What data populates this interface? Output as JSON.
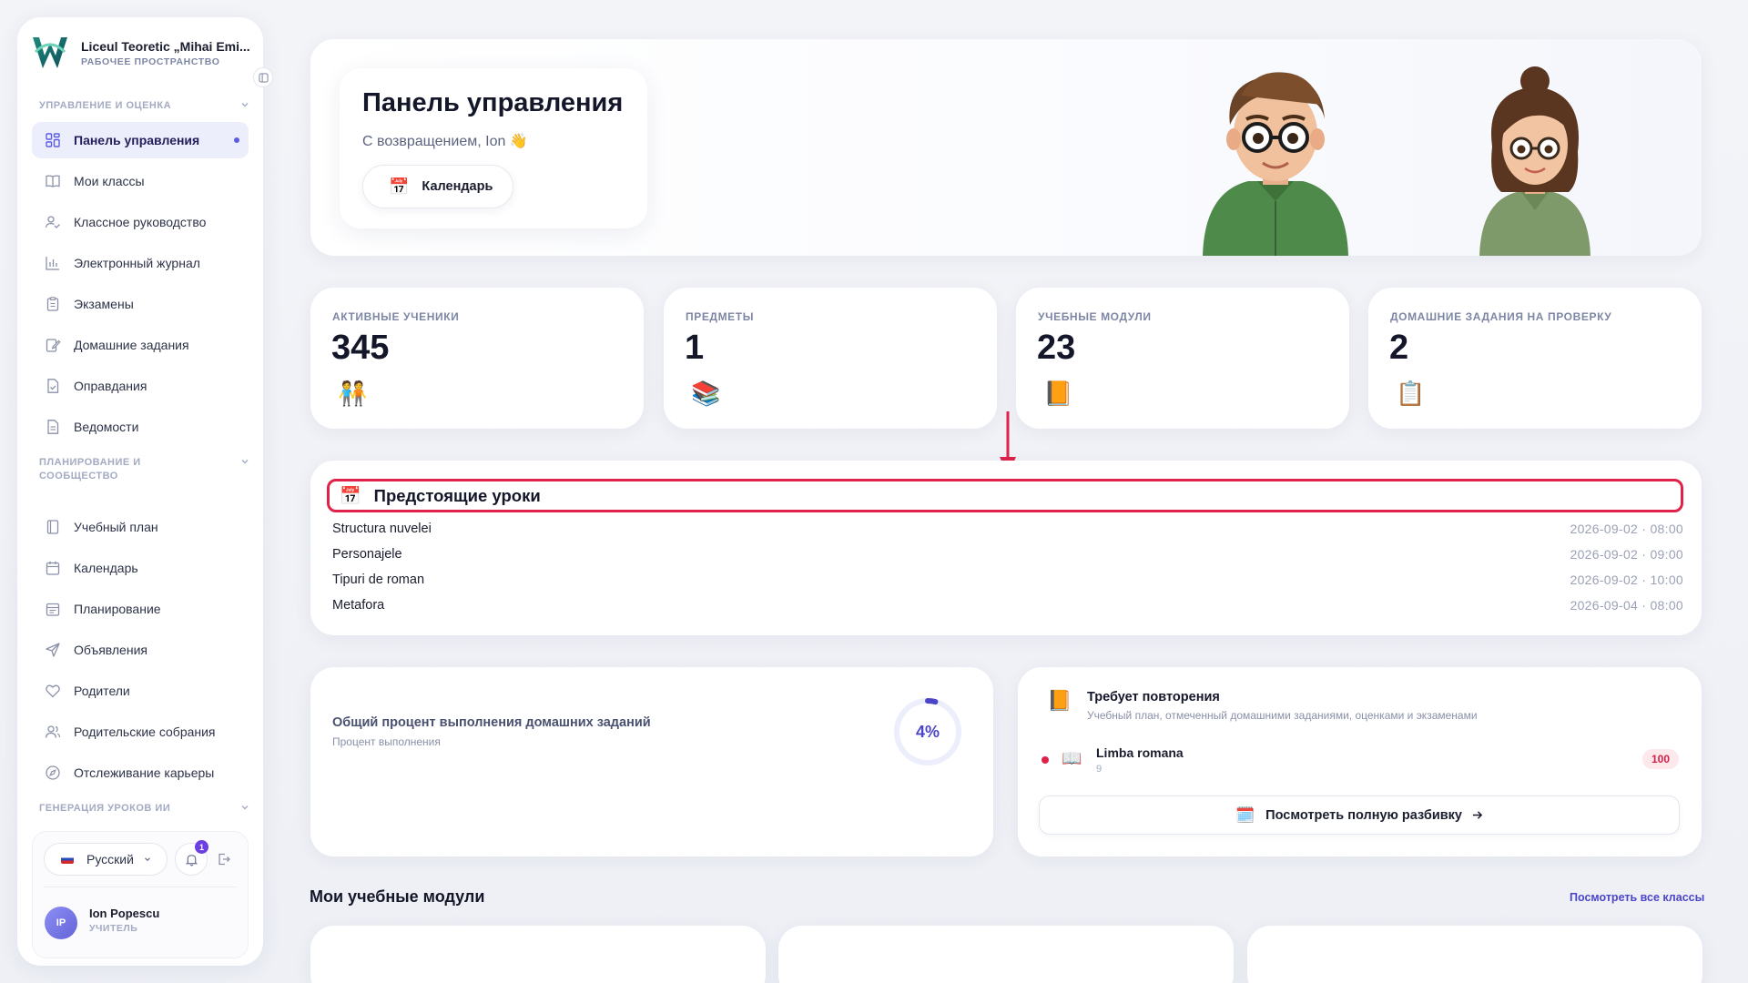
{
  "sidebar": {
    "brand_name": "Liceul Teoretic „Mihai Emi...",
    "brand_sub": "РАБОЧЕЕ ПРОСТРАНСТВО",
    "sections": [
      {
        "label": "УПРАВЛЕНИЕ И ОЦЕНКА"
      },
      {
        "label": "ПЛАНИРОВАНИЕ И СООБЩЕСТВО"
      },
      {
        "label": "ГЕНЕРАЦИЯ УРОКОВ ИИ"
      }
    ],
    "items": [
      {
        "label": "Панель управления",
        "icon": "dashboard-icon",
        "active": true
      },
      {
        "label": "Мои классы",
        "icon": "book-icon"
      },
      {
        "label": "Классное руководство",
        "icon": "user-check-icon"
      },
      {
        "label": "Электронный журнал",
        "icon": "bar-chart-icon"
      },
      {
        "label": "Экзамены",
        "icon": "clipboard-icon"
      },
      {
        "label": "Домашние задания",
        "icon": "edit-icon"
      },
      {
        "label": "Оправдания",
        "icon": "file-check-icon"
      },
      {
        "label": "Ведомости",
        "icon": "file-text-icon"
      },
      {
        "label": "Учебный план",
        "icon": "notebook-icon"
      },
      {
        "label": "Календарь",
        "icon": "calendar-icon"
      },
      {
        "label": "Планирование",
        "icon": "calendar-list-icon"
      },
      {
        "label": "Объявления",
        "icon": "send-icon"
      },
      {
        "label": "Родители",
        "icon": "heart-icon"
      },
      {
        "label": "Родительские собрания",
        "icon": "users-icon"
      },
      {
        "label": "Отслеживание карьеры",
        "icon": "compass-icon"
      }
    ],
    "language": "Русский",
    "notifications_count": "1",
    "user": {
      "initials": "IP",
      "name": "Ion Popescu",
      "role": "УЧИТЕЛЬ"
    }
  },
  "hero": {
    "title": "Панель управления",
    "subtitle": "С возвращением, Ion 👋",
    "calendar_button": "Календарь"
  },
  "stats": [
    {
      "label": "АКТИВНЫЕ УЧЕНИКИ",
      "value": "345",
      "icon": "🧑‍🤝‍🧑"
    },
    {
      "label": "ПРЕДМЕТЫ",
      "value": "1",
      "icon": "📚"
    },
    {
      "label": "УЧЕБНЫЕ МОДУЛИ",
      "value": "23",
      "icon": "📙"
    },
    {
      "label": "ДОМАШНИЕ ЗАДАНИЯ НА ПРОВЕРКУ",
      "value": "2",
      "icon": "📋"
    }
  ],
  "lessons": {
    "title": "Предстоящие уроки",
    "items": [
      {
        "name": "Structura nuvelei",
        "time": "2026-09-02 · 08:00"
      },
      {
        "name": "Personajele",
        "time": "2026-09-02 · 09:00"
      },
      {
        "name": "Tipuri de roman",
        "time": "2026-09-02 · 10:00"
      },
      {
        "name": "Metafora",
        "time": "2026-09-04 · 08:00"
      }
    ]
  },
  "homework": {
    "title": "Общий процент выполнения домашних заданий",
    "subtitle": "Процент выполнения",
    "percent": 4,
    "percent_label": "4%"
  },
  "review": {
    "title": "Требует повторения",
    "subtitle": "Учебный план, отмеченный домашними заданиями, оценками и экзаменами",
    "subject": "Limba romana",
    "subject_count": "9",
    "score": "100",
    "button": "Посмотреть полную разбивку"
  },
  "modules": {
    "title": "Мои учебные модули",
    "link": "Посмотреть все классы"
  },
  "colors": {
    "accent": "#4b45c8",
    "highlight": "#e0224a",
    "ring_track": "#eceefb"
  }
}
